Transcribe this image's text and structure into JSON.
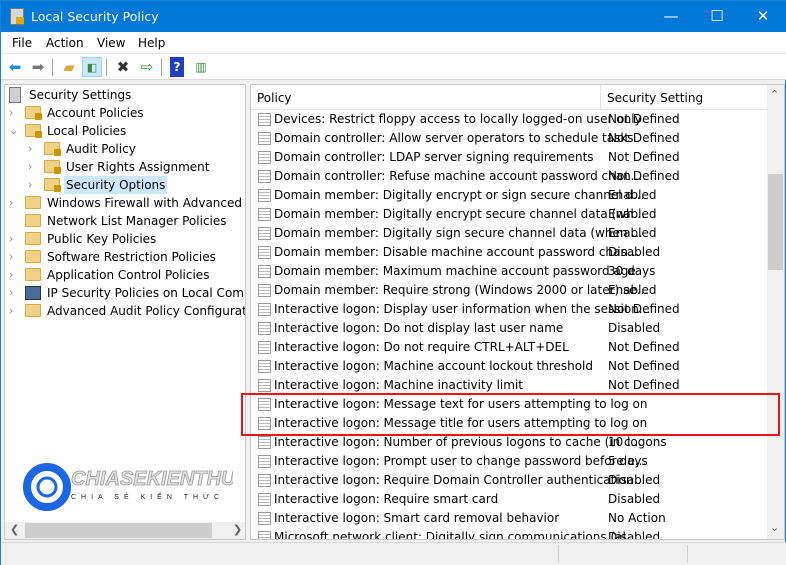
{
  "window": {
    "title": "Local Security Policy",
    "minimize": "—",
    "maximize": "☐",
    "close": "✕"
  },
  "menu": [
    "File",
    "Action",
    "View",
    "Help"
  ],
  "toolbar": {
    "icons": [
      "back-icon",
      "forward-icon",
      "up-folder-icon",
      "show-hide-tree-icon",
      "delete-icon",
      "export-list-icon",
      "help-icon",
      "action-pane-icon"
    ]
  },
  "tree": {
    "root": "Security Settings",
    "items": [
      {
        "label": "Account Policies",
        "level": 1,
        "expander": "›"
      },
      {
        "label": "Local Policies",
        "level": 1,
        "expander": "⌄"
      },
      {
        "label": "Audit Policy",
        "level": 2,
        "expander": "›"
      },
      {
        "label": "User Rights Assignment",
        "level": 2,
        "expander": "›"
      },
      {
        "label": "Security Options",
        "level": 2,
        "expander": "›",
        "selected": true
      },
      {
        "label": "Windows Firewall with Advanced Security",
        "level": 1,
        "expander": "›"
      },
      {
        "label": "Network List Manager Policies",
        "level": 1,
        "expander": ""
      },
      {
        "label": "Public Key Policies",
        "level": 1,
        "expander": "›"
      },
      {
        "label": "Software Restriction Policies",
        "level": 1,
        "expander": "›"
      },
      {
        "label": "Application Control Policies",
        "level": 1,
        "expander": "›"
      },
      {
        "label": "IP Security Policies on Local Computer",
        "level": 1,
        "expander": "›"
      },
      {
        "label": "Advanced Audit Policy Configuration",
        "level": 1,
        "expander": "›"
      }
    ]
  },
  "list": {
    "columns": [
      "Policy",
      "Security Setting"
    ],
    "sort_indicator": "^",
    "rows": [
      {
        "policy": "Devices: Restrict floppy access to locally logged-on user only",
        "setting": "Not Defined"
      },
      {
        "policy": "Domain controller: Allow server operators to schedule tasks",
        "setting": "Not Defined"
      },
      {
        "policy": "Domain controller: LDAP server signing requirements",
        "setting": "Not Defined"
      },
      {
        "policy": "Domain controller: Refuse machine account password chan...",
        "setting": "Not Defined"
      },
      {
        "policy": "Domain member: Digitally encrypt or sign secure channel d...",
        "setting": "Enabled"
      },
      {
        "policy": "Domain member: Digitally encrypt secure channel data (wh...",
        "setting": "Enabled"
      },
      {
        "policy": "Domain member: Digitally sign secure channel data (when ...",
        "setting": "Enabled"
      },
      {
        "policy": "Domain member: Disable machine account password chan...",
        "setting": "Disabled"
      },
      {
        "policy": "Domain member: Maximum machine account password age",
        "setting": "30 days"
      },
      {
        "policy": "Domain member: Require strong (Windows 2000 or later) se...",
        "setting": "Enabled"
      },
      {
        "policy": "Interactive logon: Display user information when the session...",
        "setting": "Not Defined"
      },
      {
        "policy": "Interactive logon: Do not display last user name",
        "setting": "Disabled"
      },
      {
        "policy": "Interactive logon: Do not require CTRL+ALT+DEL",
        "setting": "Not Defined"
      },
      {
        "policy": "Interactive logon: Machine account lockout threshold",
        "setting": "Not Defined"
      },
      {
        "policy": "Interactive logon: Machine inactivity limit",
        "setting": "Not Defined"
      },
      {
        "policy": "Interactive logon: Message text for users attempting to log on",
        "setting": ""
      },
      {
        "policy": "Interactive logon: Message title for users attempting to log on",
        "setting": ""
      },
      {
        "policy": "Interactive logon: Number of previous logons to cache (in c...",
        "setting": "10 logons"
      },
      {
        "policy": "Interactive logon: Prompt user to change password before e...",
        "setting": "5 days"
      },
      {
        "policy": "Interactive logon: Require Domain Controller authentication...",
        "setting": "Disabled"
      },
      {
        "policy": "Interactive logon: Require smart card",
        "setting": "Disabled"
      },
      {
        "policy": "Interactive logon: Smart card removal behavior",
        "setting": "No Action"
      },
      {
        "policy": "Microsoft network client: Digitally sign communications (al",
        "setting": "Disabled"
      }
    ]
  },
  "watermark": {
    "brand": "CHIASEKIENTHUC",
    "tagline": "CHIA SẺ KIẾN THỨC"
  },
  "colors": {
    "titlebar": "#0078d7",
    "highlight": "#e8141b",
    "selection": "#cce8ff"
  }
}
